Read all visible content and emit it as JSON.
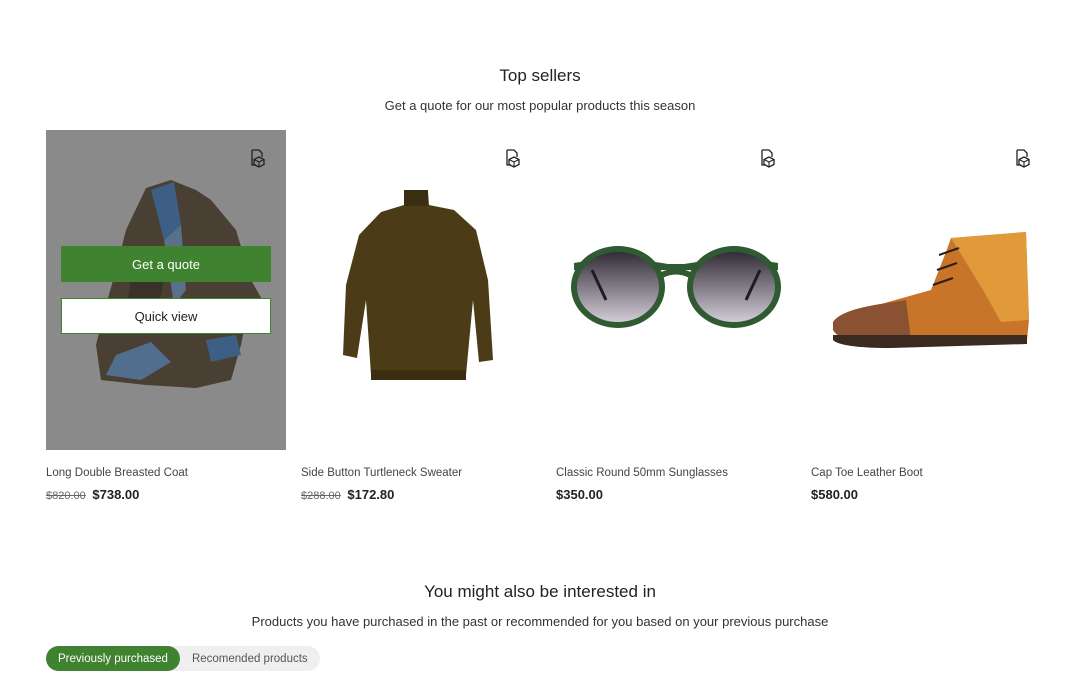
{
  "top_sellers": {
    "title": "Top sellers",
    "subtitle": "Get a quote for our most popular products this season",
    "products": [
      {
        "name": "Long Double Breasted Coat",
        "old_price": "$820.00",
        "price": "$738.00",
        "image": "coat",
        "quote_icon": "quote-request-icon"
      },
      {
        "name": "Side Button Turtleneck Sweater",
        "old_price": "$288.00",
        "price": "$172.80",
        "image": "sweater",
        "quote_icon": "quote-request-icon"
      },
      {
        "name": "Classic Round 50mm Sunglasses",
        "old_price": "",
        "price": "$350.00",
        "image": "sunglasses",
        "quote_icon": "quote-request-icon"
      },
      {
        "name": "Cap Toe Leather Boot",
        "old_price": "",
        "price": "$580.00",
        "image": "boot",
        "quote_icon": "quote-request-icon"
      }
    ],
    "hover_actions": {
      "get_quote": "Get a quote",
      "quick_view": "Quick view"
    }
  },
  "interested": {
    "title": "You might also be interested in",
    "subtitle": "Products you have purchased in the past or recommended for you based on your previous purchase",
    "tabs": [
      {
        "label": "Previously purchased",
        "active": true
      },
      {
        "label": "Recomended products",
        "active": false
      }
    ]
  },
  "colors": {
    "accent": "#3f8230",
    "overlay": "#8a8a8a"
  }
}
